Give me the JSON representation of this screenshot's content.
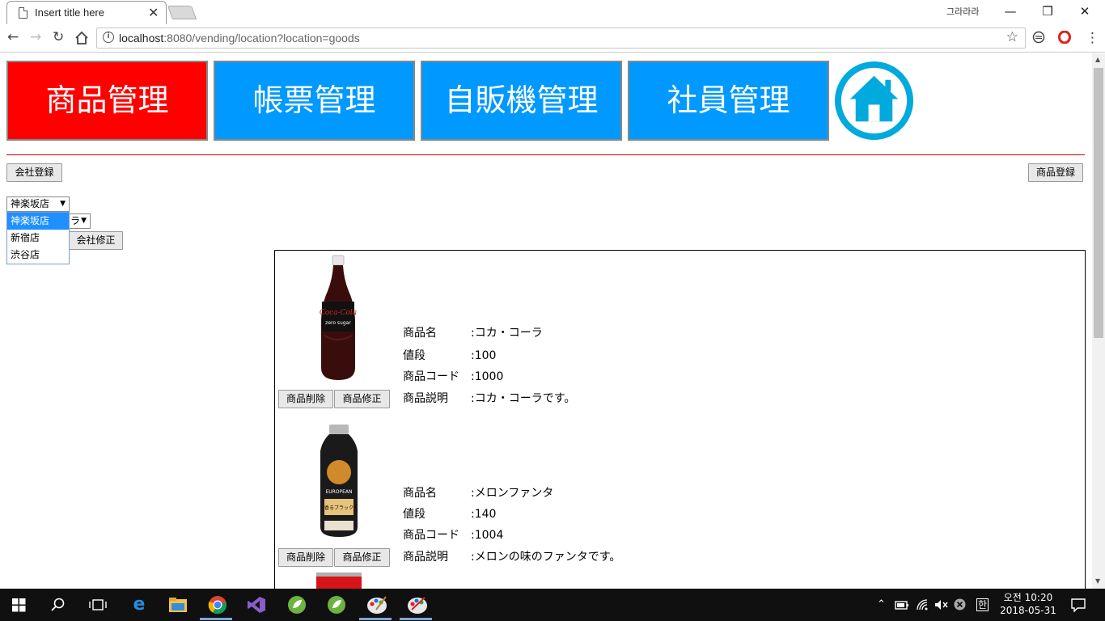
{
  "browser": {
    "tab_title": "Insert title here",
    "tab_close": "✕",
    "user_label": "그라라라",
    "url_host": "localhost",
    "url_rest": ":8080/vending/location?location=goods"
  },
  "nav": {
    "tiles": [
      {
        "label": "商品管理",
        "color": "#ff0000"
      },
      {
        "label": "帳票管理",
        "color": "#0099ff"
      },
      {
        "label": "自販機管理",
        "color": "#0099ff"
      },
      {
        "label": "社員管理",
        "color": "#0099ff"
      }
    ],
    "home_color": "#00aadd"
  },
  "accent_line_color": "#cc0000",
  "buttons": {
    "company_register": "会社登録",
    "goods_register": "商品登録",
    "company_edit": "会社修正"
  },
  "store_select": {
    "value": "神楽坂店",
    "options": [
      "神楽坂店",
      "新宿店",
      "渋谷店"
    ],
    "partial_second": "ラ"
  },
  "goods": [
    {
      "delete_label": "商品削除",
      "edit_label": "商品修正",
      "labels": [
        "商品名",
        "値段",
        "商品コード",
        "商品説明"
      ],
      "name": ":コカ・コーラ",
      "price": ":100",
      "code": ":1000",
      "desc": ":コカ・コーラです。"
    },
    {
      "delete_label": "商品削除",
      "edit_label": "商品修正",
      "labels": [
        "商品名",
        "値段",
        "商品コード",
        "商品説明"
      ],
      "name": ":メロンファンタ",
      "price": ":140",
      "code": ":1004",
      "desc": ":メロンの味のファンタです。"
    }
  ],
  "taskbar": {
    "clock_time": "오전 10:20",
    "clock_date": "2018-05-31",
    "ime": "한"
  }
}
